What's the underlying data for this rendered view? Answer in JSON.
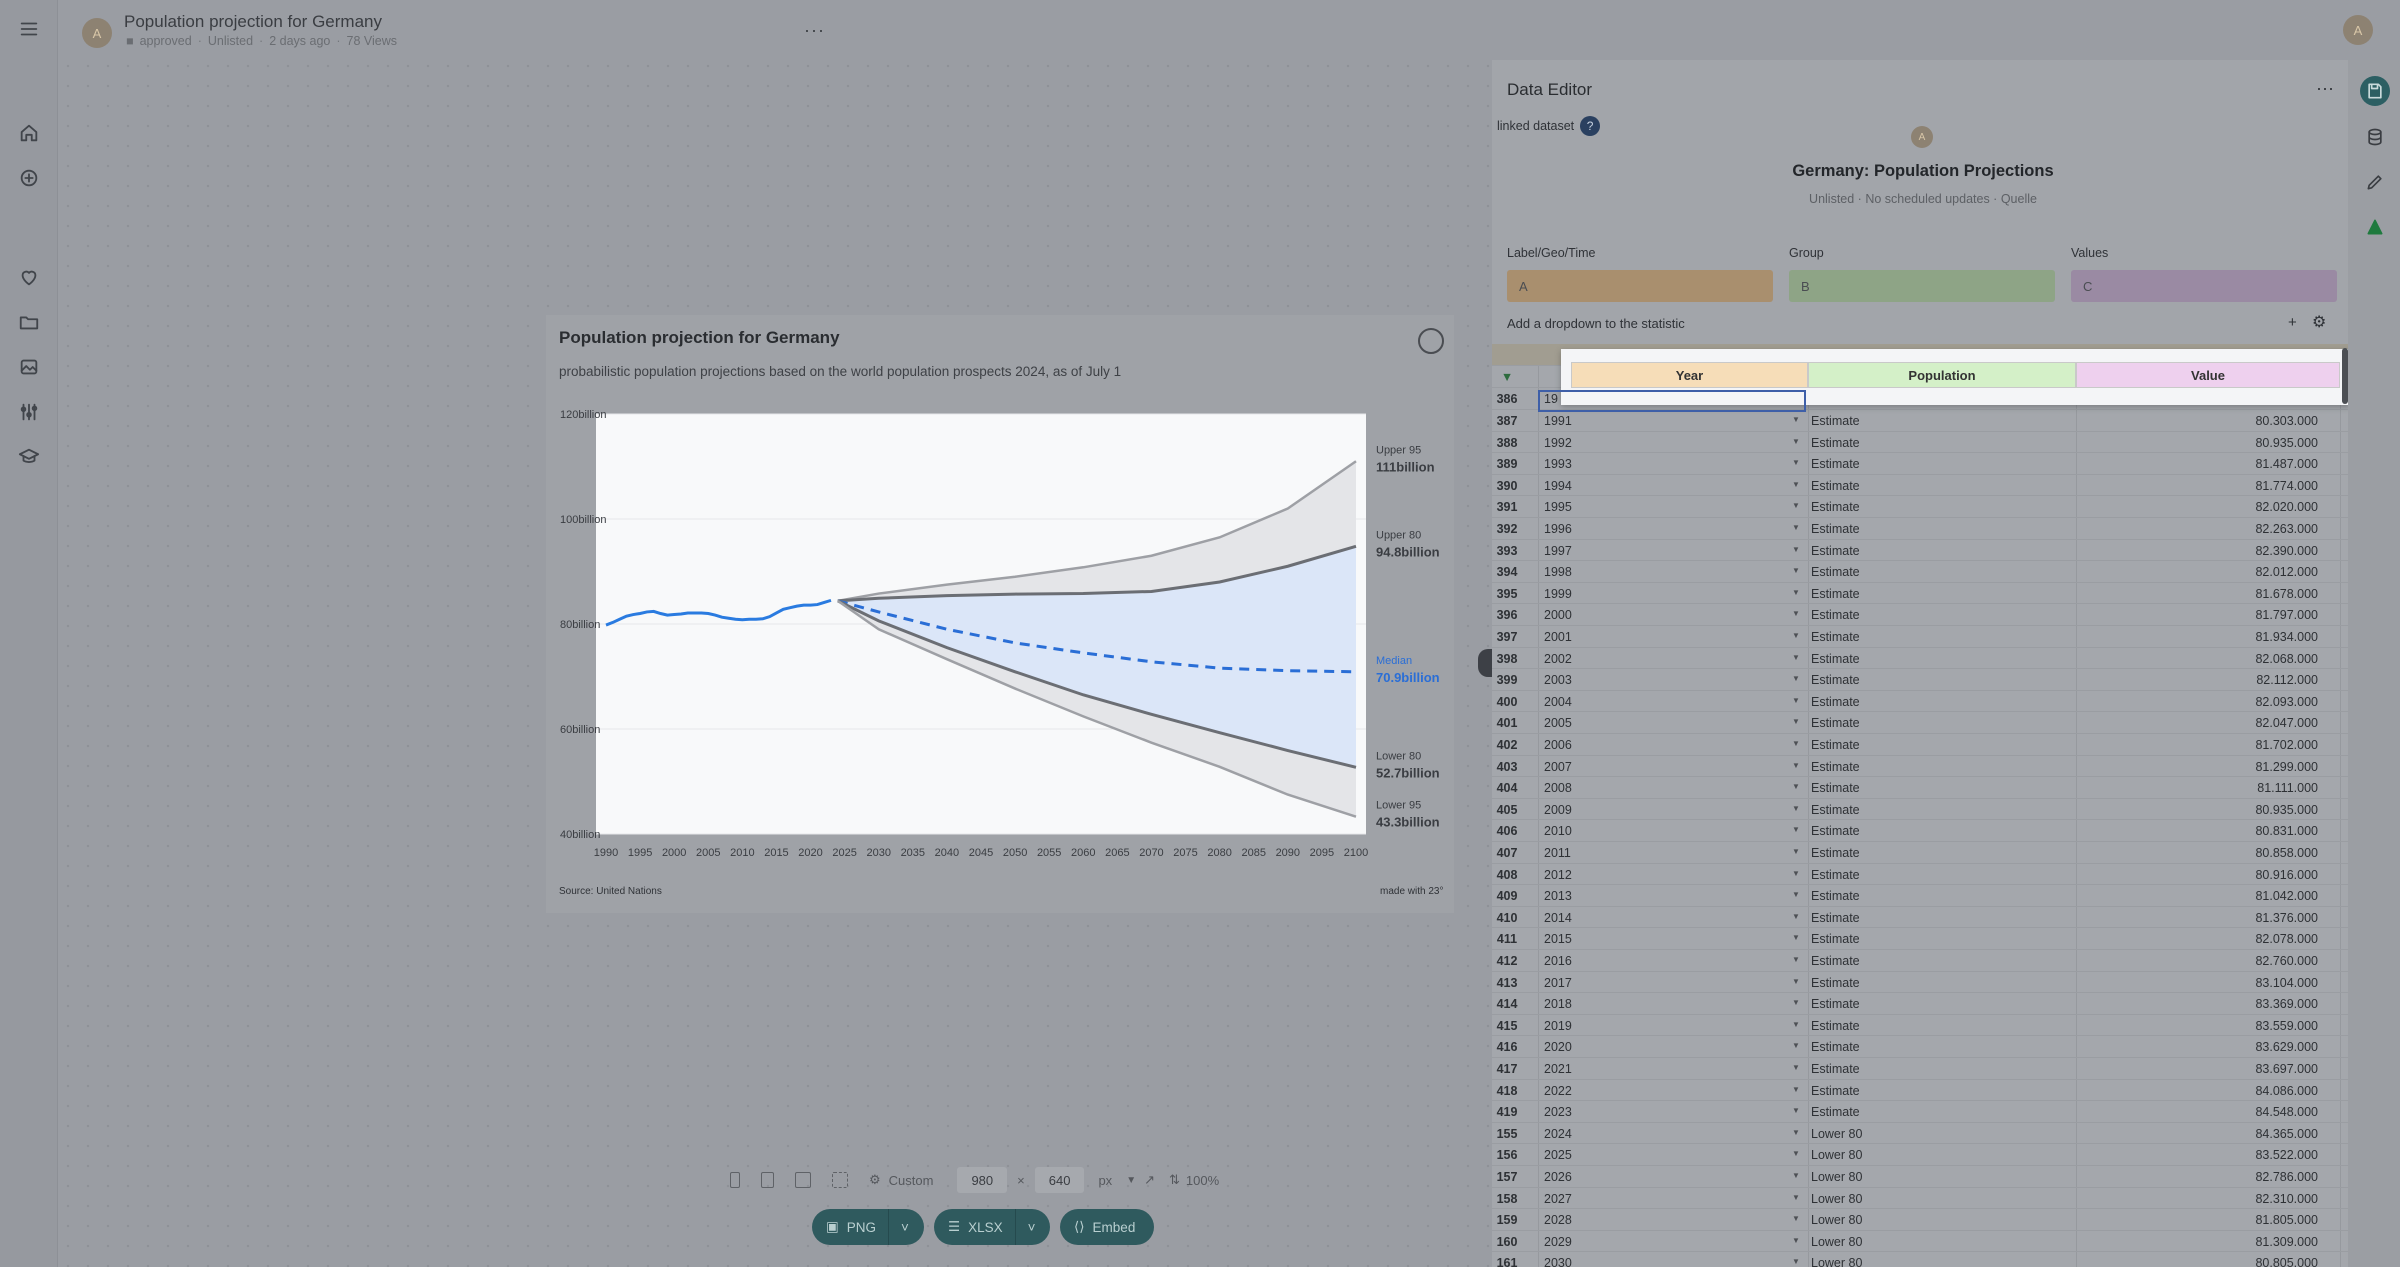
{
  "header": {
    "title": "Population projection for Germany",
    "meta": {
      "folder": "approved",
      "visibility": "Unlisted",
      "updated": "2 days ago",
      "views": "78 Views"
    },
    "avatar_letter": "A",
    "more": "···"
  },
  "user": {
    "avatar_letter": "A"
  },
  "rail": {
    "icons": [
      "menu-icon",
      "home-icon",
      "add-icon",
      "heart-icon",
      "folder-icon",
      "image-icon",
      "sliders-icon",
      "graduation-cap-icon"
    ]
  },
  "chart": {
    "title": "Population projection for Germany",
    "subtitle": "probabilistic population projections based on the world population prospects 2024, as of July 1",
    "source": "Source: United Nations",
    "made_with": "made with 23°",
    "y_ticks": [
      "120billion",
      "100billion",
      "80billion",
      "60billion",
      "40billion"
    ],
    "x_ticks": [
      "1990",
      "1995",
      "2000",
      "2005",
      "2010",
      "2015",
      "2020",
      "2025",
      "2030",
      "2035",
      "2040",
      "2045",
      "2050",
      "2055",
      "2060",
      "2065",
      "2070",
      "2075",
      "2080",
      "2085",
      "2090",
      "2095",
      "2100"
    ],
    "labels": [
      {
        "name": "Upper 95",
        "value": "111billion"
      },
      {
        "name": "Upper 80",
        "value": "94.8billion"
      },
      {
        "name": "Median",
        "value": "70.9billion"
      },
      {
        "name": "Lower 80",
        "value": "52.7billion"
      },
      {
        "name": "Lower 95",
        "value": "43.3billion"
      }
    ]
  },
  "chart_data": {
    "type": "area",
    "title": "Population projection for Germany",
    "subtitle": "probabilistic population projections based on the world population prospects 2024, as of July 1",
    "ylim": [
      40,
      120
    ],
    "xlim": [
      1990,
      2100
    ],
    "y_unit": "billion",
    "estimate": {
      "x": [
        1990,
        1991,
        1992,
        1993,
        1994,
        1995,
        1996,
        1997,
        1998,
        1999,
        2000,
        2001,
        2002,
        2003,
        2004,
        2005,
        2006,
        2007,
        2008,
        2009,
        2010,
        2011,
        2012,
        2013,
        2014,
        2015,
        2016,
        2017,
        2018,
        2019,
        2020,
        2021,
        2022,
        2023
      ],
      "y": [
        79.8,
        80.3,
        80.9,
        81.5,
        81.8,
        82.0,
        82.3,
        82.4,
        82.0,
        81.7,
        81.8,
        81.9,
        82.1,
        82.1,
        82.1,
        82.0,
        81.7,
        81.3,
        81.1,
        80.9,
        80.8,
        80.9,
        80.9,
        81.0,
        81.4,
        82.1,
        82.8,
        83.1,
        83.4,
        83.6,
        83.6,
        83.7,
        84.1,
        84.5
      ]
    },
    "series": [
      {
        "name": "Upper 95",
        "x": [
          2024,
          2030,
          2040,
          2050,
          2060,
          2070,
          2080,
          2090,
          2100
        ],
        "y": [
          84.4,
          85.8,
          87.5,
          89.0,
          90.8,
          93.0,
          96.5,
          102.0,
          111.0
        ]
      },
      {
        "name": "Upper 80",
        "x": [
          2024,
          2030,
          2040,
          2050,
          2060,
          2070,
          2080,
          2090,
          2100
        ],
        "y": [
          84.4,
          84.9,
          85.4,
          85.7,
          85.8,
          86.2,
          88.0,
          91.0,
          94.8
        ]
      },
      {
        "name": "Median",
        "x": [
          2024,
          2030,
          2040,
          2050,
          2060,
          2070,
          2080,
          2090,
          2100
        ],
        "y": [
          84.4,
          82.3,
          79.0,
          76.4,
          74.5,
          72.8,
          71.6,
          71.1,
          70.9
        ]
      },
      {
        "name": "Lower 80",
        "x": [
          2024,
          2030,
          2040,
          2050,
          2060,
          2070,
          2080,
          2090,
          2100
        ],
        "y": [
          84.4,
          80.6,
          75.5,
          70.9,
          66.5,
          62.8,
          59.3,
          55.9,
          52.7
        ]
      },
      {
        "name": "Lower 95",
        "x": [
          2024,
          2030,
          2040,
          2050,
          2060,
          2070,
          2080,
          2090,
          2100
        ],
        "y": [
          84.4,
          79.0,
          73.3,
          67.7,
          62.4,
          57.4,
          52.8,
          47.5,
          43.3
        ]
      }
    ]
  },
  "toolbar": {
    "preset": "Custom",
    "width": "980",
    "times": "×",
    "height": "640",
    "unit": "px",
    "zoom": "100%",
    "export": [
      {
        "label": "PNG"
      },
      {
        "label": "XLSX"
      },
      {
        "label": "Embed"
      }
    ]
  },
  "panel": {
    "title": "Data Editor",
    "more": "···",
    "linked_label": "linked dataset",
    "help": "?",
    "dataset_avatar": "A",
    "dataset_title": "Germany: Population Projections",
    "dataset_meta": "Unlisted · No scheduled updates · Quelle",
    "columns": [
      {
        "label": "Label/Geo/Time",
        "value": "A",
        "color": "#a98f6e"
      },
      {
        "label": "Group",
        "value": "B",
        "color": "#8ea486"
      },
      {
        "label": "Values",
        "value": "C",
        "color": "#9a8aa3"
      }
    ],
    "add_dropdown": "Add a dropdown to the statistic",
    "add_plus": "+",
    "header_cells": [
      "Year",
      "Population",
      "Value"
    ],
    "first_row": {
      "num": "386",
      "year": "19"
    },
    "rows": [
      {
        "num": "387",
        "year": "1991",
        "group": "Estimate",
        "value": "80.303.000"
      },
      {
        "num": "388",
        "year": "1992",
        "group": "Estimate",
        "value": "80.935.000"
      },
      {
        "num": "389",
        "year": "1993",
        "group": "Estimate",
        "value": "81.487.000"
      },
      {
        "num": "390",
        "year": "1994",
        "group": "Estimate",
        "value": "81.774.000"
      },
      {
        "num": "391",
        "year": "1995",
        "group": "Estimate",
        "value": "82.020.000"
      },
      {
        "num": "392",
        "year": "1996",
        "group": "Estimate",
        "value": "82.263.000"
      },
      {
        "num": "393",
        "year": "1997",
        "group": "Estimate",
        "value": "82.390.000"
      },
      {
        "num": "394",
        "year": "1998",
        "group": "Estimate",
        "value": "82.012.000"
      },
      {
        "num": "395",
        "year": "1999",
        "group": "Estimate",
        "value": "81.678.000"
      },
      {
        "num": "396",
        "year": "2000",
        "group": "Estimate",
        "value": "81.797.000"
      },
      {
        "num": "397",
        "year": "2001",
        "group": "Estimate",
        "value": "81.934.000"
      },
      {
        "num": "398",
        "year": "2002",
        "group": "Estimate",
        "value": "82.068.000"
      },
      {
        "num": "399",
        "year": "2003",
        "group": "Estimate",
        "value": "82.112.000"
      },
      {
        "num": "400",
        "year": "2004",
        "group": "Estimate",
        "value": "82.093.000"
      },
      {
        "num": "401",
        "year": "2005",
        "group": "Estimate",
        "value": "82.047.000"
      },
      {
        "num": "402",
        "year": "2006",
        "group": "Estimate",
        "value": "81.702.000"
      },
      {
        "num": "403",
        "year": "2007",
        "group": "Estimate",
        "value": "81.299.000"
      },
      {
        "num": "404",
        "year": "2008",
        "group": "Estimate",
        "value": "81.111.000"
      },
      {
        "num": "405",
        "year": "2009",
        "group": "Estimate",
        "value": "80.935.000"
      },
      {
        "num": "406",
        "year": "2010",
        "group": "Estimate",
        "value": "80.831.000"
      },
      {
        "num": "407",
        "year": "2011",
        "group": "Estimate",
        "value": "80.858.000"
      },
      {
        "num": "408",
        "year": "2012",
        "group": "Estimate",
        "value": "80.916.000"
      },
      {
        "num": "409",
        "year": "2013",
        "group": "Estimate",
        "value": "81.042.000"
      },
      {
        "num": "410",
        "year": "2014",
        "group": "Estimate",
        "value": "81.376.000"
      },
      {
        "num": "411",
        "year": "2015",
        "group": "Estimate",
        "value": "82.078.000"
      },
      {
        "num": "412",
        "year": "2016",
        "group": "Estimate",
        "value": "82.760.000"
      },
      {
        "num": "413",
        "year": "2017",
        "group": "Estimate",
        "value": "83.104.000"
      },
      {
        "num": "414",
        "year": "2018",
        "group": "Estimate",
        "value": "83.369.000"
      },
      {
        "num": "415",
        "year": "2019",
        "group": "Estimate",
        "value": "83.559.000"
      },
      {
        "num": "416",
        "year": "2020",
        "group": "Estimate",
        "value": "83.629.000"
      },
      {
        "num": "417",
        "year": "2021",
        "group": "Estimate",
        "value": "83.697.000"
      },
      {
        "num": "418",
        "year": "2022",
        "group": "Estimate",
        "value": "84.086.000"
      },
      {
        "num": "419",
        "year": "2023",
        "group": "Estimate",
        "value": "84.548.000"
      },
      {
        "num": "155",
        "year": "2024",
        "group": "Lower 80",
        "value": "84.365.000"
      },
      {
        "num": "156",
        "year": "2025",
        "group": "Lower 80",
        "value": "83.522.000"
      },
      {
        "num": "157",
        "year": "2026",
        "group": "Lower 80",
        "value": "82.786.000"
      },
      {
        "num": "158",
        "year": "2027",
        "group": "Lower 80",
        "value": "82.310.000"
      },
      {
        "num": "159",
        "year": "2028",
        "group": "Lower 80",
        "value": "81.805.000"
      },
      {
        "num": "160",
        "year": "2029",
        "group": "Lower 80",
        "value": "81.309.000"
      },
      {
        "num": "161",
        "year": "2030",
        "group": "Lower 80",
        "value": "80.805.000"
      }
    ]
  },
  "right_bar": {
    "icons": [
      "save-icon",
      "database-icon",
      "pencil-icon",
      "brand-icon"
    ]
  },
  "colors": {
    "accent": "#2f5a5e",
    "estimate": "#2a7be0",
    "median": "#2a6ed6",
    "band": "#dbe6f8"
  }
}
